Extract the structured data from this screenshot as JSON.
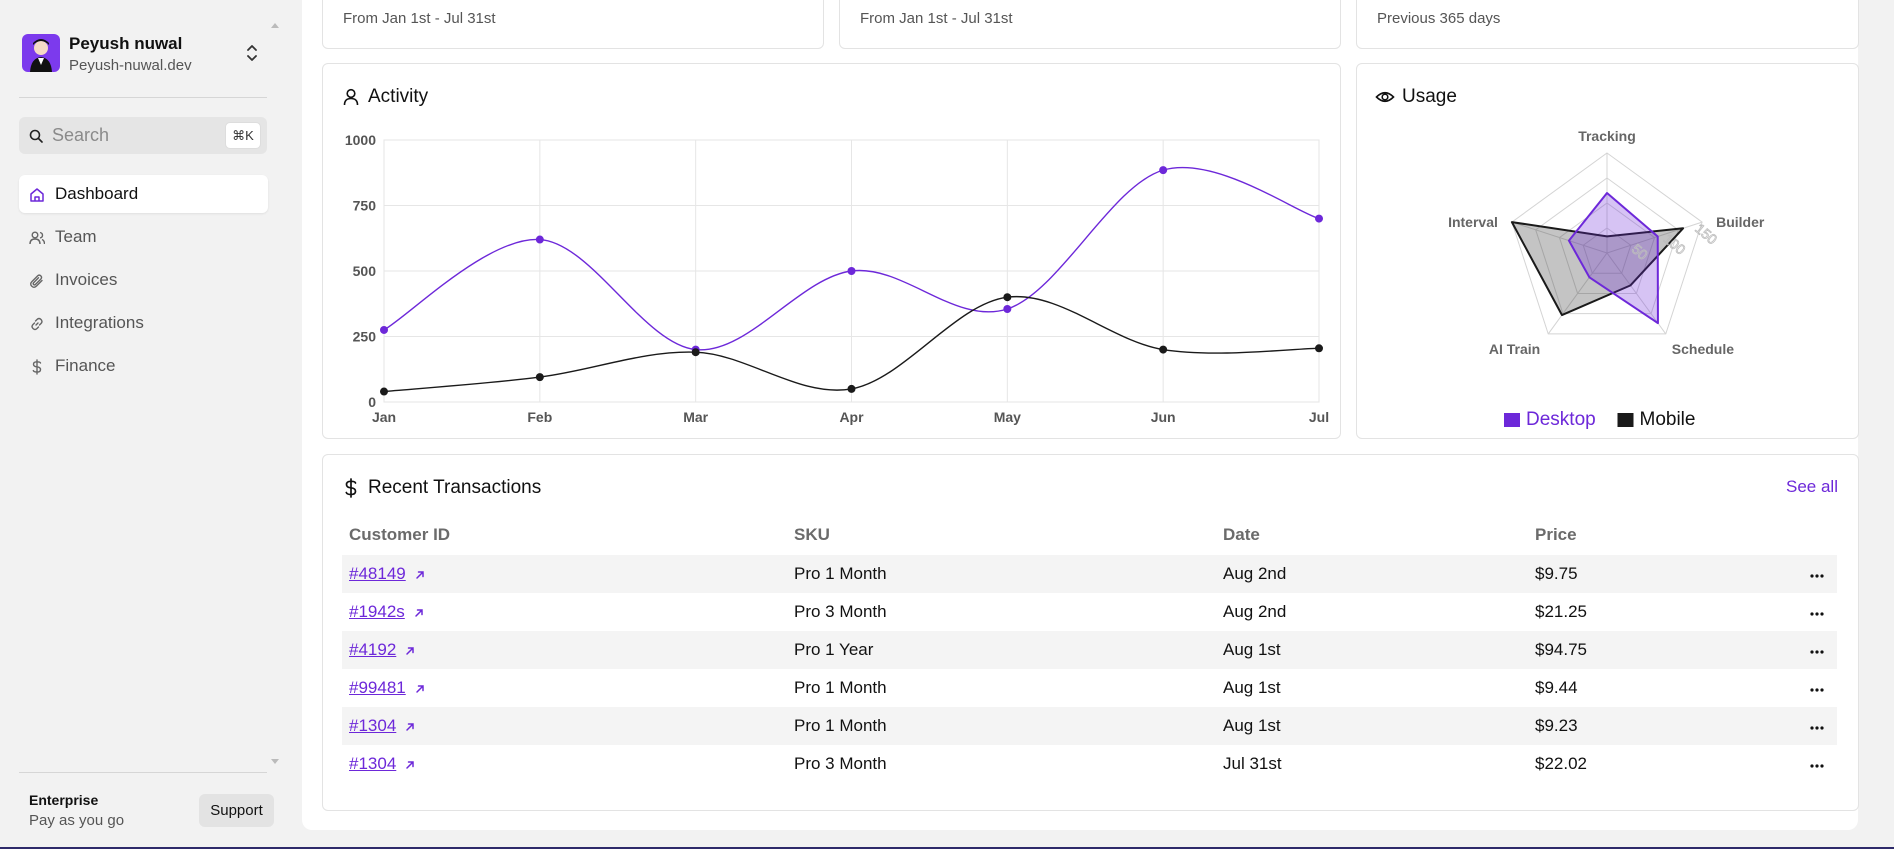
{
  "sidebar": {
    "user": {
      "name": "Peyush nuwal",
      "domain": "Peyush-nuwal.dev"
    },
    "search": {
      "placeholder": "Search",
      "shortcut": "⌘K"
    },
    "nav": [
      {
        "label": "Dashboard",
        "icon": "home-icon",
        "active": true
      },
      {
        "label": "Team",
        "icon": "users-icon",
        "active": false
      },
      {
        "label": "Invoices",
        "icon": "paperclip-icon",
        "active": false
      },
      {
        "label": "Integrations",
        "icon": "link-icon",
        "active": false
      },
      {
        "label": "Finance",
        "icon": "dollar-icon",
        "active": false
      }
    ],
    "plan": {
      "title": "Enterprise",
      "subtitle": "Pay as you go"
    },
    "support_label": "Support"
  },
  "top_cards": [
    {
      "subtitle": "From Jan 1st - Jul 31st"
    },
    {
      "subtitle": "From Jan 1st - Jul 31st"
    },
    {
      "subtitle": "Previous 365 days"
    }
  ],
  "activity": {
    "title": "Activity"
  },
  "usage": {
    "title": "Usage"
  },
  "colors": {
    "accent": "#6d28d9",
    "desktop": "#6d28d9",
    "mobile": "#1a1a1a"
  },
  "chart_data": [
    {
      "type": "line",
      "title": "Activity",
      "x": [
        "Jan",
        "Feb",
        "Mar",
        "Apr",
        "May",
        "Jun",
        "Jul"
      ],
      "ylim": [
        0,
        1000
      ],
      "yticks": [
        0,
        250,
        500,
        750,
        1000
      ],
      "grid": true,
      "series": [
        {
          "color": "#6d28d9",
          "values": [
            275,
            620,
            200,
            500,
            355,
            885,
            700
          ]
        },
        {
          "color": "#1a1a1a",
          "values": [
            40,
            95,
            190,
            50,
            400,
            200,
            205
          ]
        }
      ]
    },
    {
      "type": "radar",
      "title": "Usage",
      "axes": [
        "Tracking",
        "Builder",
        "Schedule",
        "AI Train",
        "Interval"
      ],
      "scale_labels": [
        "50",
        "100",
        "150"
      ],
      "max": 150,
      "legend": "bottom",
      "series": [
        {
          "name": "Desktop",
          "color": "#6d28d9",
          "values": [
            90,
            80,
            130,
            45,
            60
          ]
        },
        {
          "name": "Mobile",
          "color": "#1a1a1a",
          "values": [
            25,
            120,
            60,
            115,
            150
          ]
        }
      ]
    }
  ],
  "transactions": {
    "title": "Recent Transactions",
    "see_all": "See all",
    "columns": [
      "Customer ID",
      "SKU",
      "Date",
      "Price"
    ],
    "rows": [
      {
        "id": "#48149",
        "sku": "Pro 1 Month",
        "date": "Aug 2nd",
        "price": "$9.75"
      },
      {
        "id": "#1942s",
        "sku": "Pro 3 Month",
        "date": "Aug 2nd",
        "price": "$21.25"
      },
      {
        "id": "#4192",
        "sku": "Pro 1 Year",
        "date": "Aug 1st",
        "price": "$94.75"
      },
      {
        "id": "#99481",
        "sku": "Pro 1 Month",
        "date": "Aug 1st",
        "price": "$9.44"
      },
      {
        "id": "#1304",
        "sku": "Pro 1 Month",
        "date": "Aug 1st",
        "price": "$9.23"
      },
      {
        "id": "#1304",
        "sku": "Pro 3 Month",
        "date": "Jul 31st",
        "price": "$22.02"
      }
    ]
  }
}
